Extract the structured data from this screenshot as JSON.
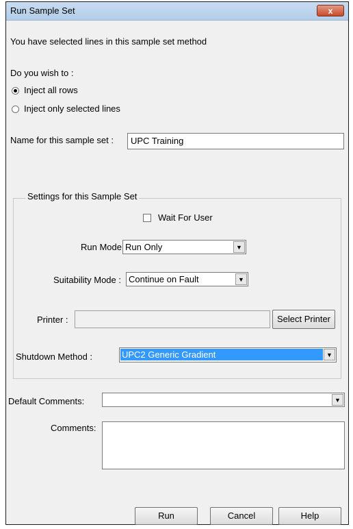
{
  "window": {
    "title": "Run Sample Set",
    "close_glyph": "x"
  },
  "message": "You have selected lines in this sample set method",
  "prompt": "Do you wish to :",
  "radios": [
    {
      "label": "Inject all rows",
      "checked": true
    },
    {
      "label": "Inject only selected lines",
      "checked": false
    }
  ],
  "name_field": {
    "label": "Name for this sample set :",
    "value": "UPC Training"
  },
  "settings": {
    "legend": "Settings for this Sample Set",
    "wait_for_user": {
      "label": "Wait For User",
      "checked": false
    },
    "run_mode": {
      "label": "Run Mode :",
      "value": "Run Only"
    },
    "suitability_mode": {
      "label": "Suitability Mode :",
      "value": "Continue on Fault"
    },
    "printer": {
      "label": "Printer :",
      "value": "",
      "button": "Select Printer"
    },
    "shutdown_method": {
      "label": "Shutdown Method :",
      "value": "UPC2 Generic Gradient",
      "highlight_color": "#3399ff"
    }
  },
  "default_comments": {
    "label": "Default Comments:",
    "value": ""
  },
  "comments": {
    "label": "Comments:",
    "value": ""
  },
  "buttons": {
    "run": "Run",
    "cancel": "Cancel",
    "help": "Help"
  },
  "icons": {
    "dropdown": "chevron-down-icon",
    "close": "close-icon"
  }
}
